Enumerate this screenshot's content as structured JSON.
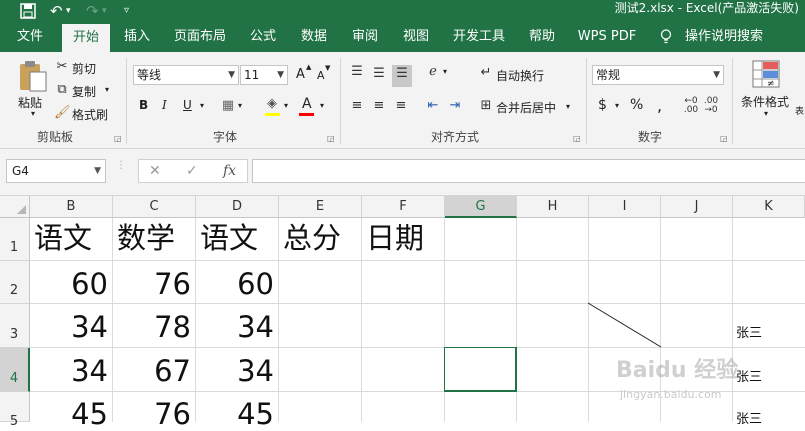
{
  "title_bar": {
    "save_icon": "save-icon",
    "undo_icon": "undo-icon",
    "redo_icon": "redo-icon",
    "customize_icon": "customize-quick-access-icon",
    "title": "测试2.xlsx  -  Excel(产品激活失败)"
  },
  "tabs": [
    "文件",
    "开始",
    "插入",
    "页面布局",
    "公式",
    "数据",
    "审阅",
    "视图",
    "开发工具",
    "帮助",
    "WPS PDF",
    "操作说明搜索"
  ],
  "active_tab": "开始",
  "ribbon": {
    "clipboard": {
      "paste": "粘贴",
      "cut": "剪切",
      "copy": "复制",
      "format_painter": "格式刷",
      "label": "剪贴板"
    },
    "font": {
      "name": "等线",
      "size": "11",
      "grow": "A",
      "shrink": "A",
      "bold": "B",
      "italic": "I",
      "underline": "U",
      "font_color": "A",
      "label": "字体",
      "fill_color_hex": "#ffff00",
      "font_color_hex": "#ff0000"
    },
    "alignment": {
      "wrap": "自动换行",
      "merge": "合并后居中",
      "label": "对齐方式"
    },
    "number": {
      "format": "常规",
      "currency": "$",
      "percent": "%",
      "comma": ",",
      "label": "数字"
    },
    "styles": {
      "conditional": "条件格式",
      "table_partial": "表"
    }
  },
  "formula_bar": {
    "name_box": "G4",
    "cancel": "✕",
    "enter": "✓",
    "fx": "fx",
    "value": ""
  },
  "sheet": {
    "columns": [
      "B",
      "C",
      "D",
      "E",
      "F",
      "G",
      "H",
      "I",
      "J",
      "K"
    ],
    "selected_column": "G",
    "rows": [
      "1",
      "2",
      "3",
      "4",
      "5"
    ],
    "selected_row": "4",
    "header_row": [
      "语文",
      "数学",
      "语文",
      "总分",
      "日期"
    ],
    "data": [
      [
        "60",
        "76",
        "60"
      ],
      [
        "34",
        "78",
        "34"
      ],
      [
        "34",
        "67",
        "34"
      ],
      [
        "45",
        "76",
        "45"
      ]
    ],
    "k_column": [
      "张三",
      "张三",
      "张三"
    ]
  },
  "watermark": {
    "main": "Baidu 经验",
    "sub": "jingyan.baidu.com"
  },
  "colors": {
    "excel_green": "#217346",
    "ribbon_bg": "#f3f3f3"
  }
}
